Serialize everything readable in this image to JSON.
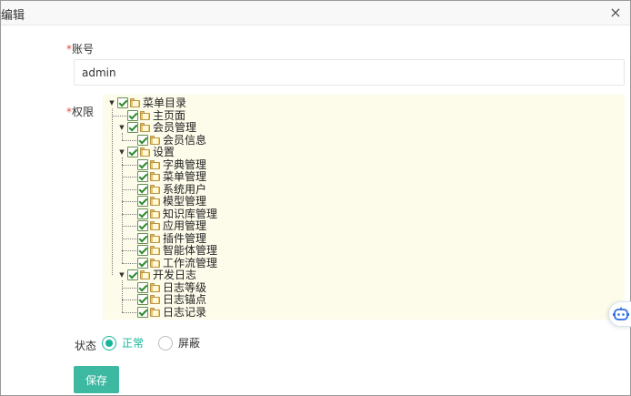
{
  "dialog": {
    "title": "编辑",
    "close_glyph": "×"
  },
  "form": {
    "account_label": "账号",
    "account_value": "admin",
    "permission_label": "权限",
    "status_label": "状态",
    "required_mark": "*",
    "status_options": [
      {
        "label": "正常",
        "checked": true
      },
      {
        "label": "屏蔽",
        "checked": false
      }
    ],
    "save_label": "保存"
  },
  "tree": {
    "items": [
      {
        "label": "菜单目录",
        "level": 0,
        "expanded": true,
        "checked": true
      },
      {
        "label": "主页面",
        "level": 1,
        "checked": true
      },
      {
        "label": "会员管理",
        "level": 1,
        "expanded": true,
        "checked": true
      },
      {
        "label": "会员信息",
        "level": 2,
        "checked": true
      },
      {
        "label": "设置",
        "level": 1,
        "expanded": true,
        "checked": true
      },
      {
        "label": "字典管理",
        "level": 2,
        "checked": true
      },
      {
        "label": "菜单管理",
        "level": 2,
        "checked": true
      },
      {
        "label": "系统用户",
        "level": 2,
        "checked": true
      },
      {
        "label": "模型管理",
        "level": 2,
        "checked": true
      },
      {
        "label": "知识库管理",
        "level": 2,
        "checked": true
      },
      {
        "label": "应用管理",
        "level": 2,
        "checked": true
      },
      {
        "label": "插件管理",
        "level": 2,
        "checked": true
      },
      {
        "label": "智能体管理",
        "level": 2,
        "checked": true
      },
      {
        "label": "工作流管理",
        "level": 2,
        "checked": true
      },
      {
        "label": "开发日志",
        "level": 1,
        "expanded": true,
        "checked": true
      },
      {
        "label": "日志等级",
        "level": 2,
        "checked": true
      },
      {
        "label": "日志锚点",
        "level": 2,
        "checked": true
      },
      {
        "label": "日志记录",
        "level": 2,
        "checked": true
      }
    ]
  },
  "icons": {
    "folder": "folder-icon",
    "checkbox": "checkbox-checked-icon",
    "expand": "triangle-down-icon",
    "assistant": "robot-assistant-icon"
  },
  "colors": {
    "accent": "#16b69a",
    "button": "#3db9a1",
    "required": "#e54d42",
    "tree_background": "#fdfbea"
  }
}
